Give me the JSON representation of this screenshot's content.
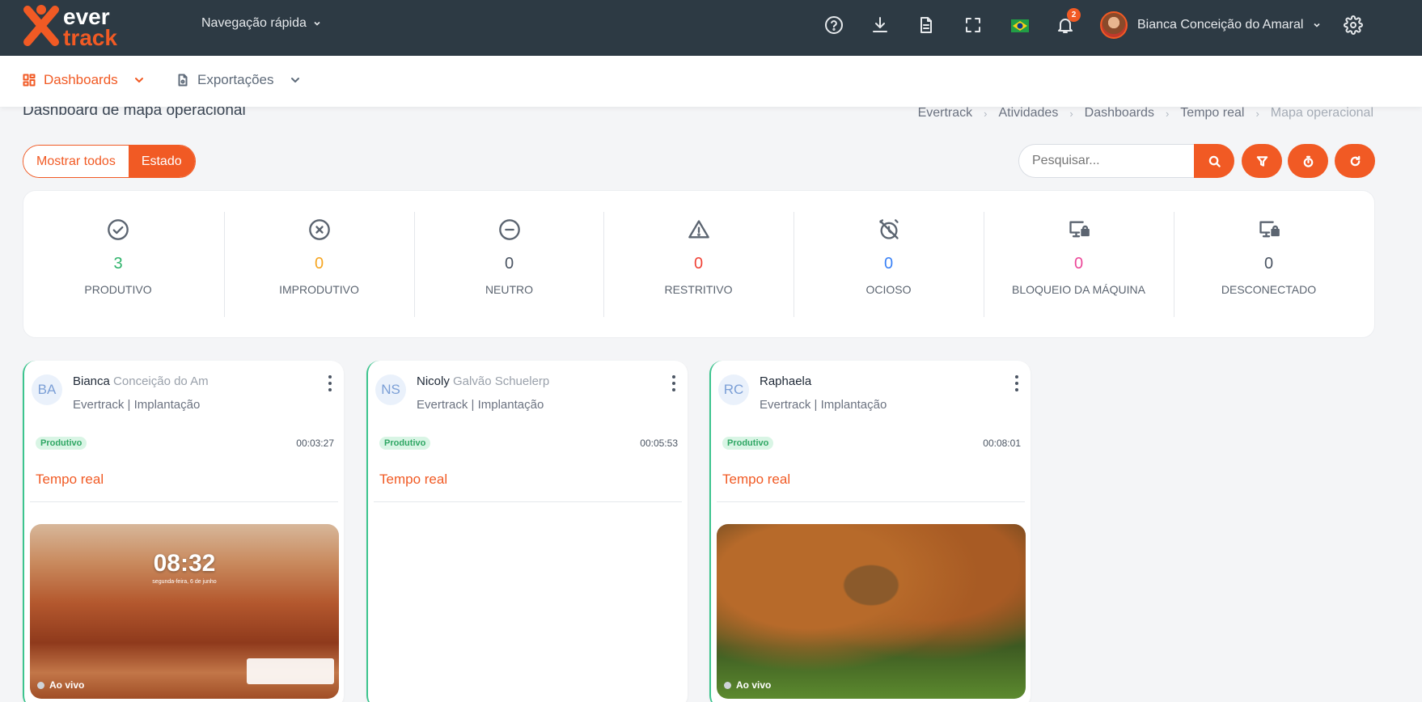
{
  "header": {
    "logo_text": [
      "ever",
      "track"
    ],
    "quick_nav_label": "Navegação rápida",
    "notification_count": "2",
    "user_name": "Bianca Conceição do Amaral"
  },
  "menu": {
    "items": [
      {
        "label": "Dashboards",
        "active": true
      },
      {
        "label": "Exportações",
        "active": false
      }
    ]
  },
  "page": {
    "title": "Dashboard de mapa operacional",
    "breadcrumb": [
      "Evertrack",
      "Atividades",
      "Dashboards",
      "Tempo real",
      "Mapa operacional"
    ]
  },
  "toggle": {
    "show_all": "Mostrar todos",
    "state": "Estado"
  },
  "search": {
    "placeholder": "Pesquisar..."
  },
  "stats": [
    {
      "value": "3",
      "label": "PRODUTIVO",
      "color": "#2fb36b",
      "icon": "check-circle-icon"
    },
    {
      "value": "0",
      "label": "IMPRODUTIVO",
      "color": "#f6a623",
      "icon": "x-circle-icon"
    },
    {
      "value": "0",
      "label": "NEUTRO",
      "color": "#4b5563",
      "icon": "minus-circle-icon"
    },
    {
      "value": "0",
      "label": "RESTRITIVO",
      "color": "#f04438",
      "icon": "warning-icon"
    },
    {
      "value": "0",
      "label": "OCIOSO",
      "color": "#3b82f6",
      "icon": "alarm-off-icon"
    },
    {
      "value": "0",
      "label": "BLOQUEIO DA MÁQUINA",
      "color": "#ec4899",
      "icon": "monitor-lock-icon"
    },
    {
      "value": "0",
      "label": "DESCONECTADO",
      "color": "#4b5563",
      "icon": "monitor-lock-icon"
    }
  ],
  "cards": [
    {
      "initials": "BA",
      "name": "Bianca",
      "name_blurred": "Conceição do Am",
      "org": "Evertrack | Implantação",
      "status": "Produtivo",
      "time": "00:03:27",
      "section": "Tempo real",
      "live_label": "Ao vivo",
      "screen_clock": "08:32",
      "screen_date": "segunda-feira, 6 de junho"
    },
    {
      "initials": "NS",
      "name": "Nicoly",
      "name_blurred": "Galvão Schuelerp",
      "org": "Evertrack | Implantação",
      "status": "Produtivo",
      "time": "00:05:53",
      "section": "Tempo real"
    },
    {
      "initials": "RC",
      "name": "Raphaela",
      "name_blurred": "",
      "org": "Evertrack | Implantação",
      "status": "Produtivo",
      "time": "00:08:01",
      "section": "Tempo real",
      "live_label": "Ao vivo"
    }
  ]
}
